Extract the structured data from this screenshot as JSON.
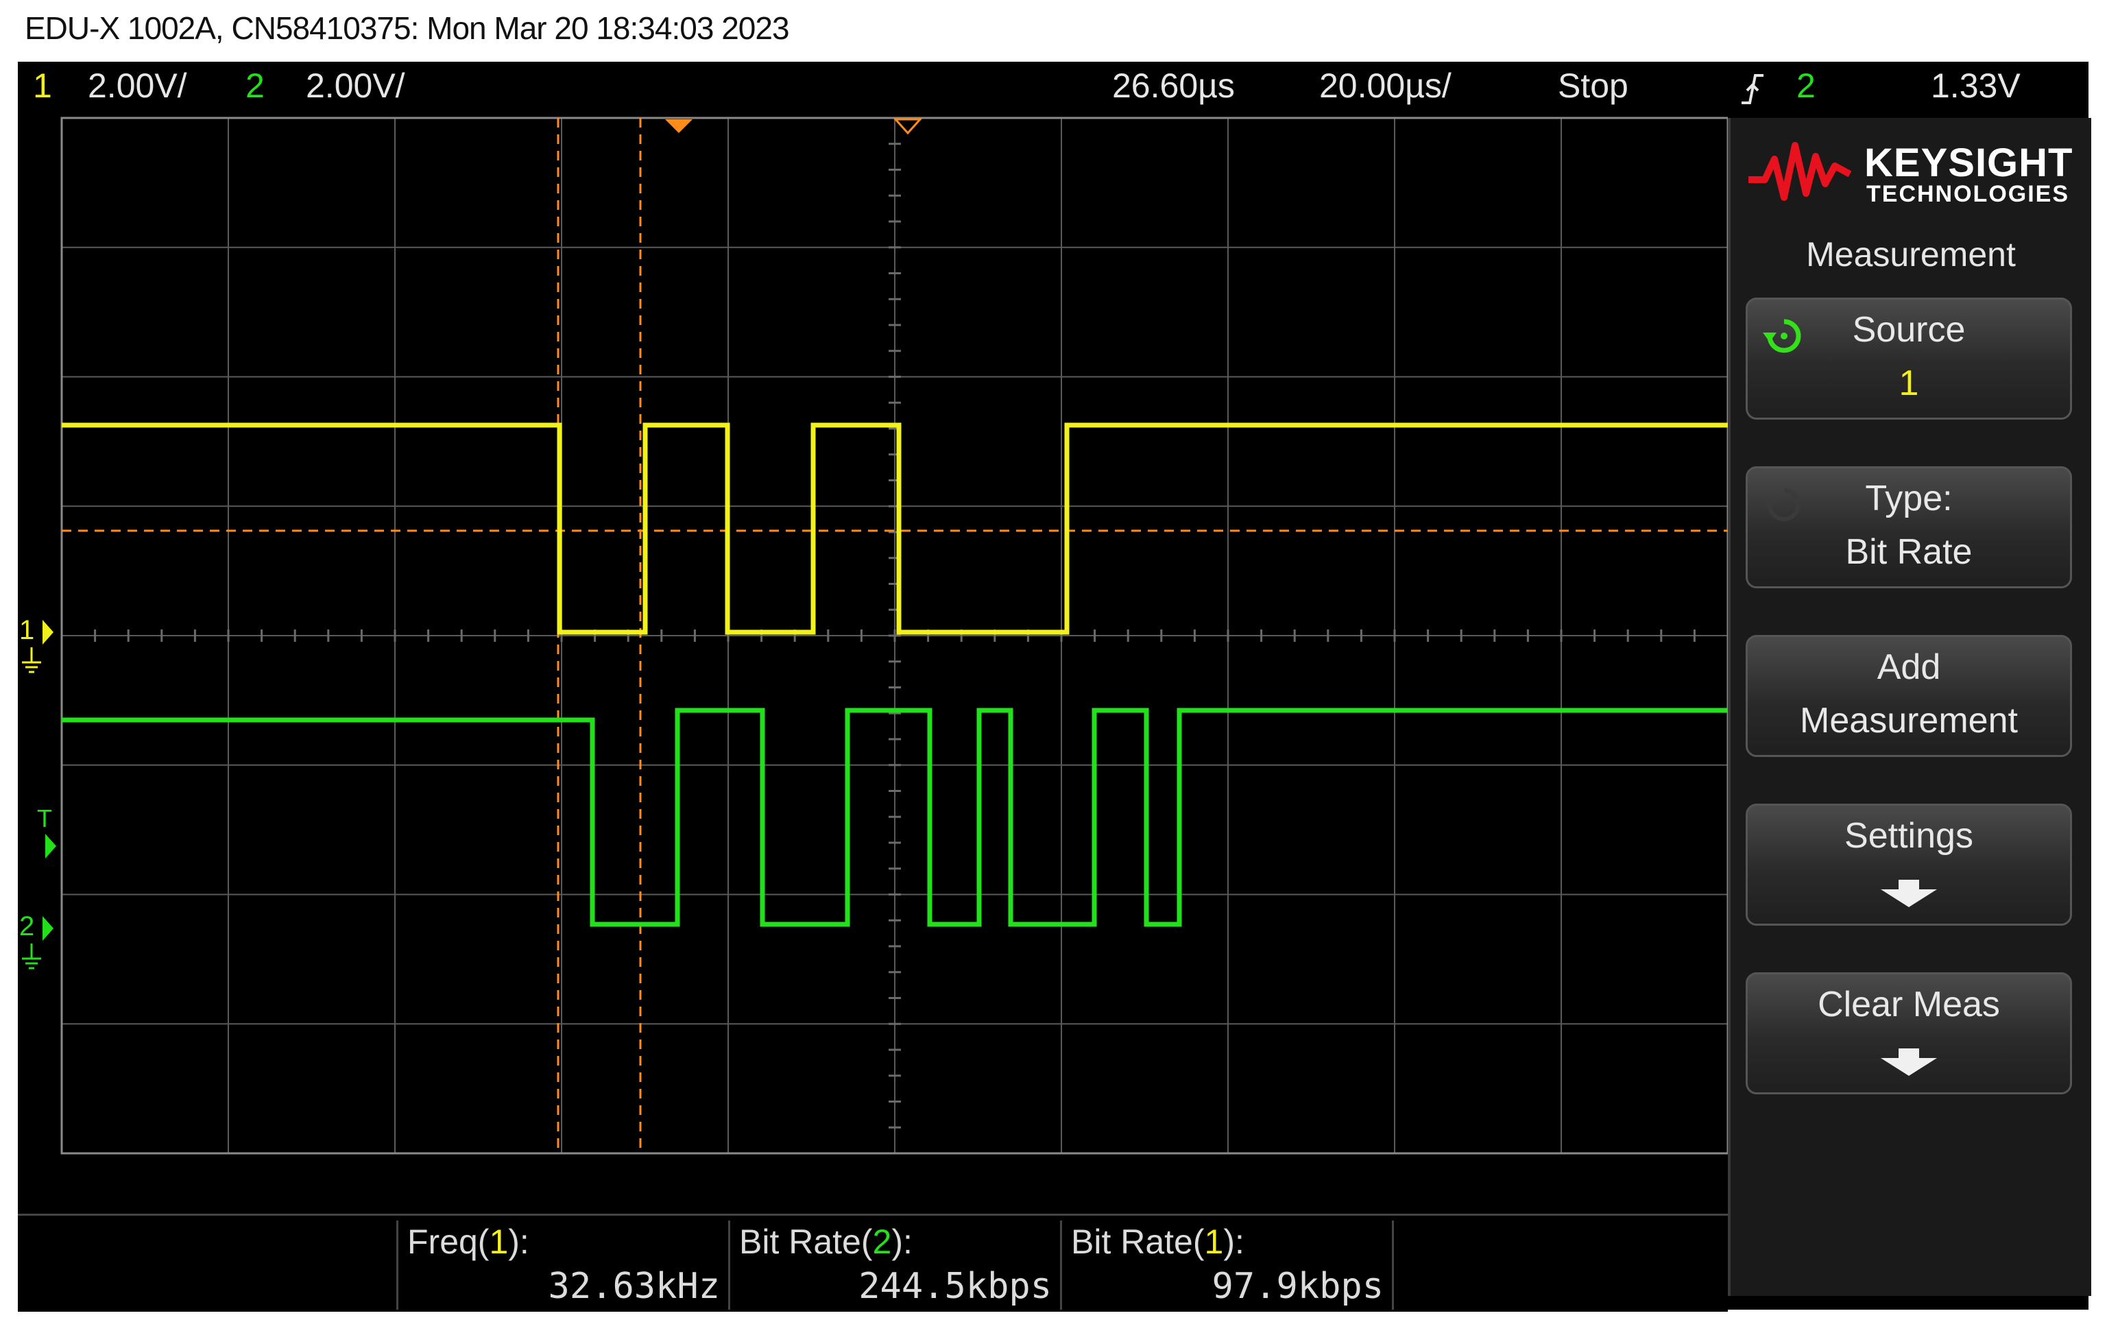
{
  "window_title": "EDU-X 1002A, CN58410375: Mon Mar 20 18:34:03 2023",
  "status": {
    "ch1_num": "1",
    "ch1_scale": "2.00V/",
    "ch2_num": "2",
    "ch2_scale": "2.00V/",
    "delay": "26.60µs",
    "timebase": "20.00µs/",
    "run_state": "Stop",
    "trigger_icon": "trigger-edge-icon",
    "trigger_source": "2",
    "trigger_level": "1.33V"
  },
  "markers": {
    "ch1_marker": "1",
    "ch2_marker": "2",
    "trigger_marker": "T"
  },
  "side_panel": {
    "brand": "KEYSIGHT",
    "brand_sub": "TECHNOLOGIES",
    "title": "Measurement",
    "softkeys": [
      {
        "line1": "Source",
        "line2": "1",
        "icon": "rotate-knob-icon"
      },
      {
        "line1": "Type:",
        "line2": "Bit Rate",
        "icon": "rotate-knob-icon"
      },
      {
        "line1": "Add",
        "line2": "Measurement"
      },
      {
        "line1": "Settings",
        "icon": "down-arrow-icon"
      },
      {
        "line1": "Clear Meas",
        "icon": "down-arrow-icon"
      }
    ]
  },
  "measurements": [
    {
      "prefix": "Freq(",
      "channel": "1",
      "suffix": "):",
      "value": "32.63kHz"
    },
    {
      "prefix": "Bit Rate(",
      "channel": "2",
      "suffix": "):",
      "value": "244.5kbps"
    },
    {
      "prefix": "Bit Rate(",
      "channel": "1",
      "suffix": "):",
      "value": "97.9kbps"
    }
  ],
  "colors": {
    "ch1": "#f2f21a",
    "ch2": "#22e01a",
    "cursor": "#ff8c1a",
    "grid": "#555555",
    "background": "#000000"
  }
}
